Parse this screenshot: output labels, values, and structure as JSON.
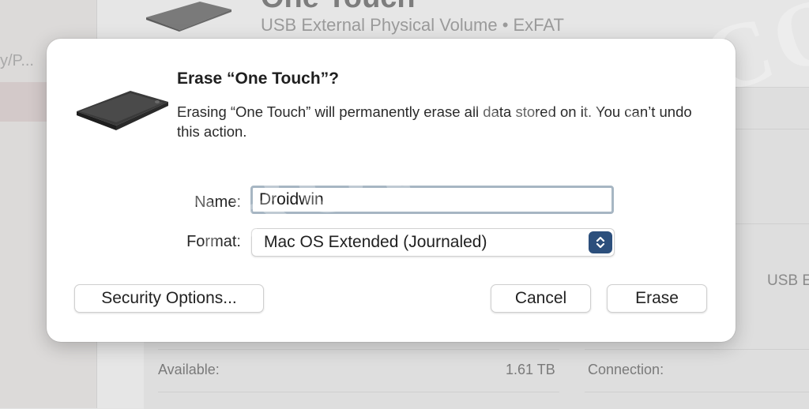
{
  "background": {
    "sidebar_crumb": "y/P...",
    "volume_title": "One Touch",
    "volume_subtitle": "USB External Physical Volume • ExFAT",
    "connection_value": "USB E",
    "available_label": "Available:",
    "available_value": "1.61 TB",
    "connection_label": "Connection:"
  },
  "watermark": "DROIDWIN.COM",
  "dialog": {
    "title": "Erase “One Touch”?",
    "message": "Erasing “One Touch” will permanently erase all data stored on it. You can’t undo this action.",
    "name_label": "Name:",
    "name_value": "Droidwin",
    "format_label": "Format:",
    "format_value": "Mac OS Extended (Journaled)",
    "security_button": "Security Options...",
    "cancel_button": "Cancel",
    "erase_button": "Erase"
  },
  "icons": {
    "drive": "external-drive-icon",
    "stepper": "up-down-chevron-icon"
  },
  "colors": {
    "stepper_accent": "#2c4f7c",
    "focus_ring": "#a7b6c3"
  }
}
